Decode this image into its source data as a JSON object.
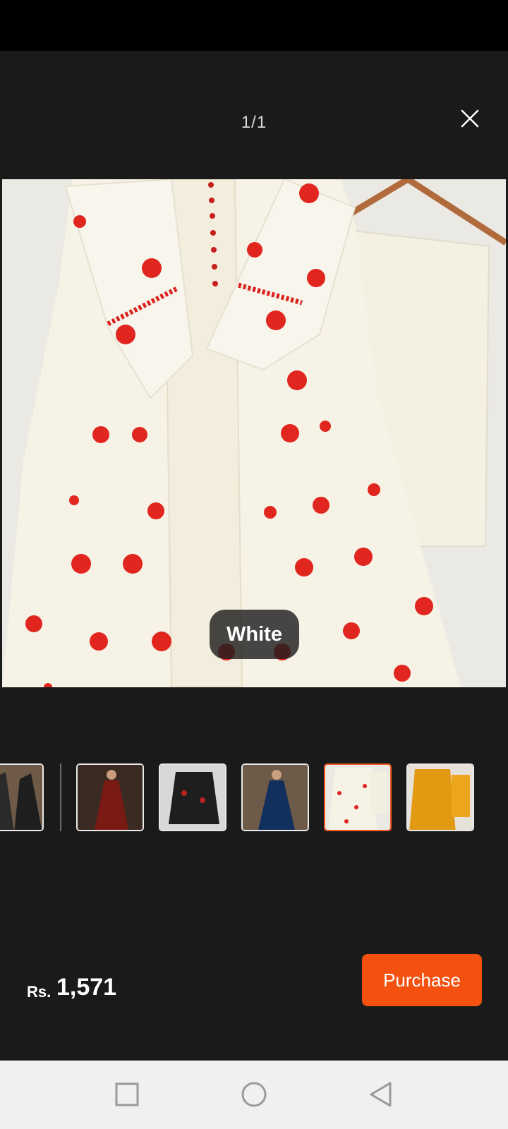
{
  "viewer": {
    "page_counter": "1/1",
    "close_icon": "close-icon",
    "variant_label": "White"
  },
  "thumbnails": [
    {
      "variant": "Black",
      "color": "#2a2a2a",
      "selected": false
    },
    {
      "variant": "Maroon",
      "color": "#7a1a14",
      "selected": false
    },
    {
      "variant": "Black",
      "color": "#1e1e1e",
      "selected": false
    },
    {
      "variant": "Blue",
      "color": "#12305e",
      "selected": false
    },
    {
      "variant": "White",
      "color": "#f3efe4",
      "selected": true
    },
    {
      "variant": "Mustard",
      "color": "#e29a12",
      "selected": false
    }
  ],
  "price": {
    "currency": "Rs.",
    "value": "1,571"
  },
  "actions": {
    "purchase_label": "Purchase"
  },
  "colors": {
    "accent": "#f45110",
    "selected_border": "#f05a22",
    "background": "#1a1a1b"
  },
  "system_nav": {
    "recents_icon": "square-icon",
    "home_icon": "circle-icon",
    "back_icon": "triangle-back-icon"
  }
}
